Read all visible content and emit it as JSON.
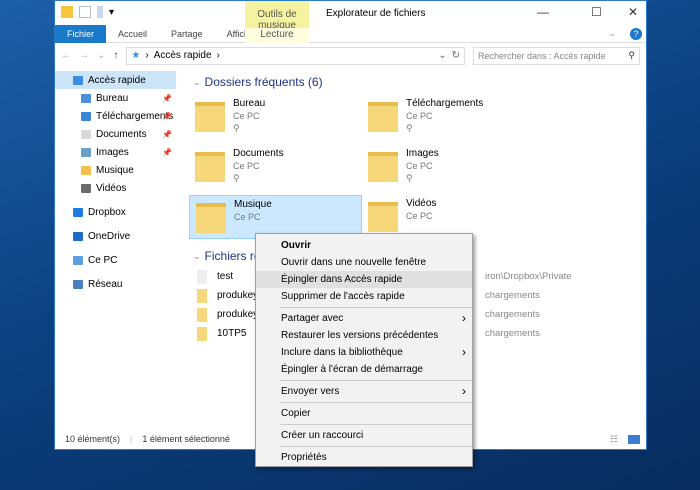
{
  "window": {
    "title": "Explorateur de fichiers",
    "context_tab": "Outils de musique",
    "context_subtab": "Lecture"
  },
  "ribbon": {
    "tabs": [
      "Fichier",
      "Accueil",
      "Partage",
      "Affichage"
    ]
  },
  "address": {
    "path": "Accès rapide",
    "search_placeholder": "Rechercher dans : Accès rapide"
  },
  "sidebar": {
    "items": [
      {
        "label": "Accès rapide",
        "icon": "star-icon",
        "sub": false,
        "pinned": false,
        "selected": true
      },
      {
        "label": "Bureau",
        "icon": "desktop-icon",
        "sub": true,
        "pinned": true
      },
      {
        "label": "Téléchargements",
        "icon": "download-icon",
        "sub": true,
        "pinned": true
      },
      {
        "label": "Documents",
        "icon": "documents-icon",
        "sub": true,
        "pinned": true
      },
      {
        "label": "Images",
        "icon": "images-icon",
        "sub": true,
        "pinned": true
      },
      {
        "label": "Musique",
        "icon": "music-icon",
        "sub": true,
        "pinned": false
      },
      {
        "label": "Vidéos",
        "icon": "videos-icon",
        "sub": true,
        "pinned": false
      },
      {
        "label": "Dropbox",
        "icon": "dropbox-icon",
        "sub": false,
        "gap": true
      },
      {
        "label": "OneDrive",
        "icon": "onedrive-icon",
        "sub": false,
        "gap": true
      },
      {
        "label": "Ce PC",
        "icon": "pc-icon",
        "sub": false,
        "gap": true
      },
      {
        "label": "Réseau",
        "icon": "network-icon",
        "sub": false,
        "gap": true
      }
    ]
  },
  "frequent": {
    "header": "Dossiers fréquents (6)",
    "folders": [
      {
        "name": "Bureau",
        "sub": "Ce PC",
        "pinned": true
      },
      {
        "name": "Téléchargements",
        "sub": "Ce PC",
        "pinned": true
      },
      {
        "name": "Documents",
        "sub": "Ce PC",
        "pinned": true
      },
      {
        "name": "Images",
        "sub": "Ce PC",
        "pinned": true
      },
      {
        "name": "Musique",
        "sub": "Ce PC",
        "selected": true
      },
      {
        "name": "Vidéos",
        "sub": "Ce PC"
      }
    ]
  },
  "recent": {
    "header": "Fichiers récents",
    "files": [
      {
        "name": "test",
        "loc": "iron\\Dropbox\\Private"
      },
      {
        "name": "produkey",
        "loc": "chargements"
      },
      {
        "name": "produkey_",
        "loc": "chargements"
      },
      {
        "name": "10TP5",
        "loc": "chargements"
      }
    ]
  },
  "status": {
    "count": "10 élément(s)",
    "selected": "1 élément sélectionné"
  },
  "context_menu": {
    "groups": [
      [
        {
          "label": "Ouvrir",
          "bold": true
        },
        {
          "label": "Ouvrir dans une nouvelle fenêtre"
        },
        {
          "label": "Épingler dans Accès rapide",
          "hover": true
        },
        {
          "label": "Supprimer de l'accès rapide"
        }
      ],
      [
        {
          "label": "Partager avec",
          "submenu": true
        },
        {
          "label": "Restaurer les versions précédentes"
        },
        {
          "label": "Inclure dans la bibliothèque",
          "submenu": true
        },
        {
          "label": "Épingler à l'écran de démarrage"
        }
      ],
      [
        {
          "label": "Envoyer vers",
          "submenu": true
        }
      ],
      [
        {
          "label": "Copier"
        }
      ],
      [
        {
          "label": "Créer un raccourci"
        }
      ],
      [
        {
          "label": "Propriétés"
        }
      ]
    ]
  },
  "colors": {
    "accent": "#1979ca",
    "selection": "#cce8ff",
    "context_tab": "#f5f3a0",
    "header": "#1e3287"
  }
}
